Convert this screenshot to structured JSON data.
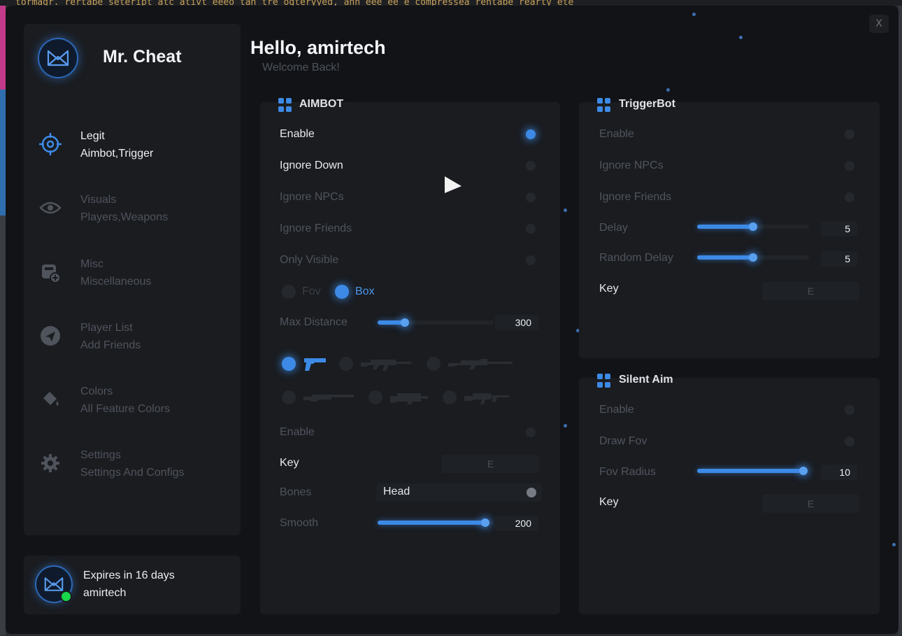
{
  "background_code": "tormagr. rertabe seteript atc ativt eeeo tan tre ogteryyed, ann eee ee e compressea rentabe rearty ete",
  "window": {
    "close_label": "X"
  },
  "sidebar": {
    "brand": "Mr. Cheat",
    "items": [
      {
        "title": "Legit",
        "subtitle": "Aimbot,Trigger",
        "icon": "crosshair-icon",
        "active": true
      },
      {
        "title": "Visuals",
        "subtitle": "Players,Weapons",
        "icon": "eye-icon",
        "active": false
      },
      {
        "title": "Misc",
        "subtitle": "Miscellaneous",
        "icon": "misc-icon",
        "active": false
      },
      {
        "title": "Player List",
        "subtitle": "Add Friends",
        "icon": "send-icon",
        "active": false
      },
      {
        "title": "Colors",
        "subtitle": "All Feature Colors",
        "icon": "paint-bucket-icon",
        "active": false
      },
      {
        "title": "Settings",
        "subtitle": "Settings And Configs",
        "icon": "gear-icon",
        "active": false
      }
    ]
  },
  "user": {
    "expiry": "Expires in 16 days",
    "name": "amirtech",
    "status": "online"
  },
  "header": {
    "greeting": "Hello, amirtech",
    "welcome": "Welcome Back!"
  },
  "aimbot": {
    "title": "AIMBOT",
    "enable": {
      "label": "Enable",
      "on": true
    },
    "ignore_down": {
      "label": "Ignore Down",
      "on": false
    },
    "ignore_npcs": {
      "label": "Ignore NPCs",
      "on": false
    },
    "ignore_friends": {
      "label": "Ignore Friends",
      "on": false
    },
    "only_visible": {
      "label": "Only Visible",
      "on": false
    },
    "mode": {
      "fov_label": "Fov",
      "box_label": "Box",
      "selected": "Box"
    },
    "max_distance": {
      "label": "Max Distance",
      "value": "300",
      "fraction": 0.23
    },
    "weapons": [
      "pistol-icon",
      "assault-rifle-icon",
      "sniper-rifle-icon",
      "shotgun-icon",
      "smg-icon",
      "lmg-icon"
    ],
    "selected_weapon": "pistol-icon",
    "weapon_enable": {
      "label": "Enable",
      "on": false
    },
    "key": {
      "label": "Key",
      "value": "E"
    },
    "bones": {
      "label": "Bones",
      "value": "Head"
    },
    "smooth": {
      "label": "Smooth",
      "value": "200",
      "fraction": 0.96
    }
  },
  "triggerbot": {
    "title": "TriggerBot",
    "enable": {
      "label": "Enable",
      "on": false
    },
    "ignore_npcs": {
      "label": "Ignore NPCs",
      "on": false
    },
    "ignore_friends": {
      "label": "Ignore Friends",
      "on": false
    },
    "delay": {
      "label": "Delay",
      "value": "5",
      "fraction": 0.5
    },
    "random_delay": {
      "label": "Random Delay",
      "value": "5",
      "fraction": 0.5
    },
    "key": {
      "label": "Key",
      "value": "E"
    }
  },
  "silent_aim": {
    "title": "Silent Aim",
    "enable": {
      "label": "Enable",
      "on": false
    },
    "draw_fov": {
      "label": "Draw Fov",
      "on": false
    },
    "fov_radius": {
      "label": "Fov Radius",
      "value": "10",
      "fraction": 0.95
    },
    "key": {
      "label": "Key",
      "value": "E"
    }
  },
  "colors": {
    "accent": "#3d8ae6",
    "online": "#19d64a",
    "panel": "#1a1c20",
    "window": "#111316"
  }
}
